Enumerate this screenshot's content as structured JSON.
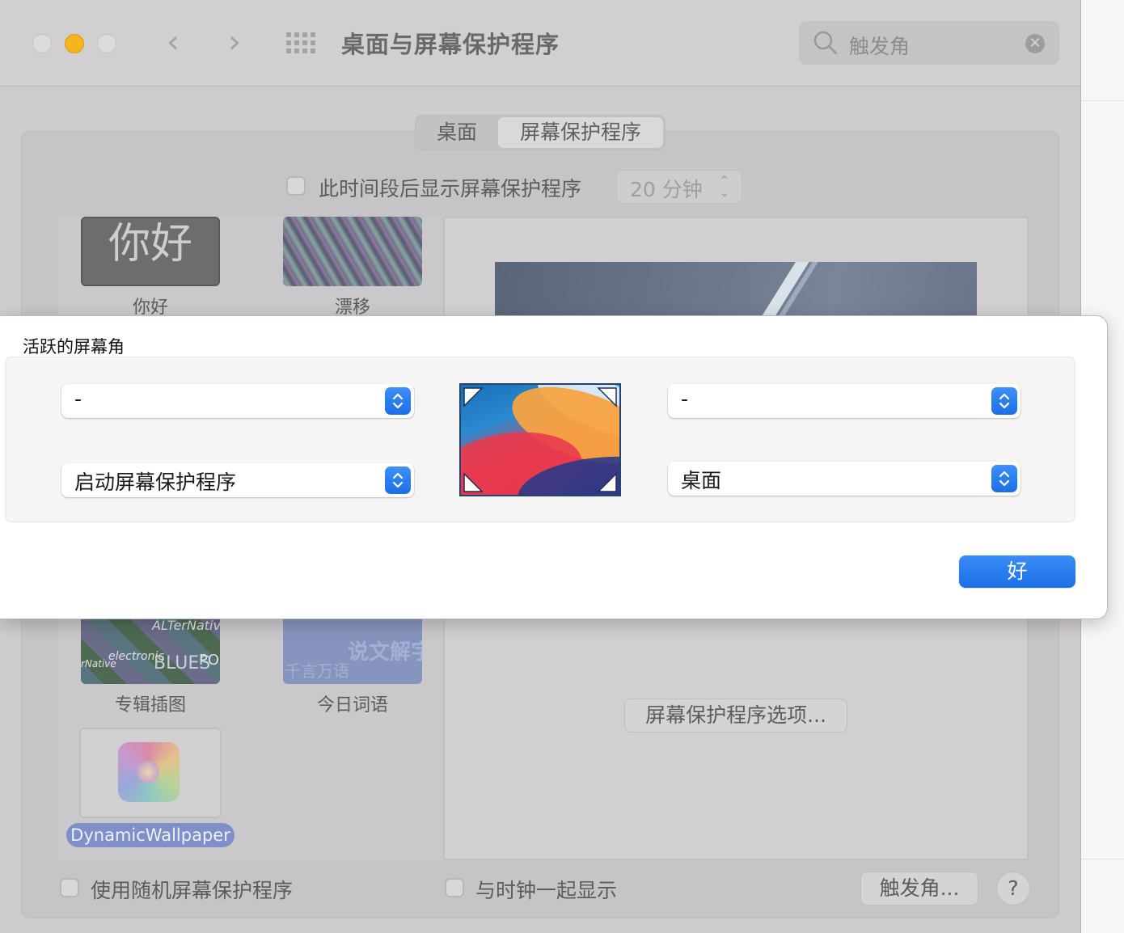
{
  "window": {
    "title": "桌面与屏幕保护程序",
    "search_placeholder": "触发角"
  },
  "tabs": [
    {
      "label": "桌面"
    },
    {
      "label": "屏幕保护程序",
      "selected": true
    }
  ],
  "screensaver": {
    "start_after_label": "此时间段后显示屏幕保护程序",
    "start_after_value": "20 分钟",
    "thumbnails": [
      {
        "label": "你好",
        "text": "你好"
      },
      {
        "label": "漂移"
      },
      {
        "label": "专辑插图",
        "texts": [
          "ALTerNative",
          "electronic",
          "BLUES",
          "POP",
          "rNative"
        ]
      },
      {
        "label": "今日词语",
        "texts": [
          "说文解字",
          "千言万语"
        ]
      },
      {
        "label": "DynamicWallpaper",
        "selected": true
      }
    ],
    "options_button": "屏幕保护程序选项...",
    "random_label": "使用随机屏幕保护程序",
    "clock_label": "与时钟一起显示",
    "hot_corners_button": "触发角...",
    "help": "?"
  },
  "sheet": {
    "heading": "活跃的屏幕角",
    "top_left": "-",
    "top_right": "-",
    "bottom_left": "启动屏幕保护程序",
    "bottom_right": "桌面",
    "ok_button": "好"
  },
  "colors": {
    "accent": "#1c6fe8",
    "selection": "#7f8fc8"
  }
}
